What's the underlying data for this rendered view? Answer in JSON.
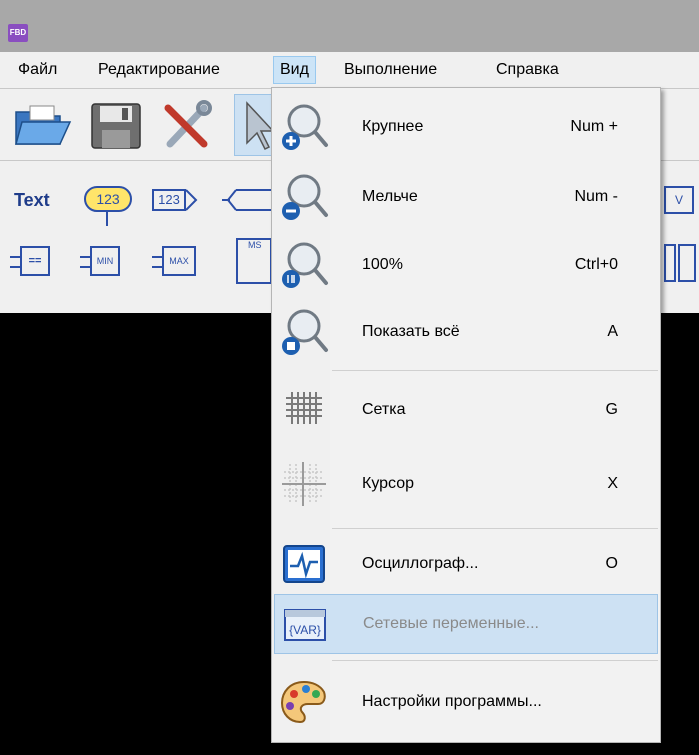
{
  "app": {
    "icon_text": "FBD"
  },
  "menubar": {
    "items": [
      {
        "label": "Файл"
      },
      {
        "label": "Редактирование"
      },
      {
        "label": "Вид"
      },
      {
        "label": "Выполнение"
      },
      {
        "label": "Справка"
      }
    ]
  },
  "toolbar": {
    "text_tool": "Text",
    "const_tool": "123",
    "const_out_tool": "123",
    "eq_block": "==",
    "min_block": "MIN",
    "max_block": "MAX",
    "mux_block": "MS",
    "var_block": "V"
  },
  "view_menu": {
    "items": [
      {
        "label": "Крупнее",
        "shortcut": "Num +",
        "icon": "zoom-in-icon"
      },
      {
        "label": "Мельче",
        "shortcut": "Num -",
        "icon": "zoom-out-icon"
      },
      {
        "label": "100%",
        "shortcut": "Ctrl+0",
        "icon": "zoom-100-icon"
      },
      {
        "label": "Показать всё",
        "shortcut": "A",
        "icon": "zoom-fit-icon"
      },
      {
        "label": "Сетка",
        "shortcut": "G",
        "icon": "grid-icon"
      },
      {
        "label": "Курсор",
        "shortcut": "X",
        "icon": "cursor-crosshair-icon"
      },
      {
        "label": "Осциллограф...",
        "shortcut": "O",
        "icon": "oscilloscope-icon"
      },
      {
        "label": "Сетевые переменные...",
        "shortcut": "",
        "icon": "network-variables-icon",
        "disabled": true
      },
      {
        "label": "Настройки программы...",
        "shortcut": "",
        "icon": "palette-icon"
      }
    ],
    "var_icon_text": "{VAR}"
  },
  "colors": {
    "menu_highlight": "#cce4f7",
    "hover_row": "#cde1f3",
    "canvas": "#000000",
    "titlebar": "#a8a8a8"
  }
}
